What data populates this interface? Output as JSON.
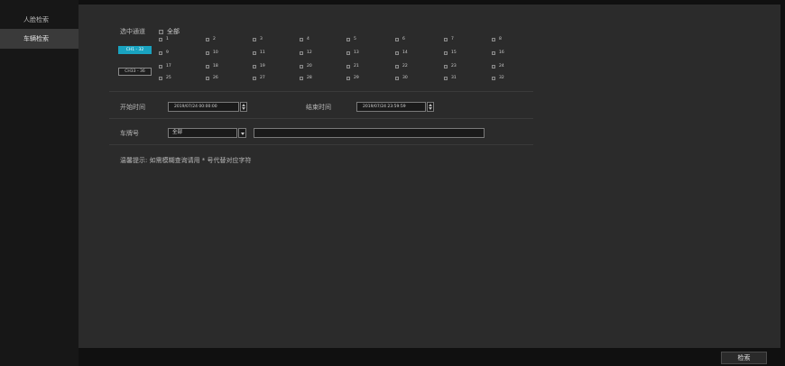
{
  "sidebar": {
    "items": [
      {
        "label": "人脸检索"
      },
      {
        "label": "车辆检索"
      }
    ]
  },
  "channels": {
    "label": "选中通道",
    "all_label": "全部",
    "groups": [
      {
        "label": "CH1 - 32"
      },
      {
        "label": "CH33 - 36"
      }
    ],
    "items": [
      "1",
      "2",
      "3",
      "4",
      "5",
      "6",
      "7",
      "8",
      "9",
      "10",
      "11",
      "12",
      "13",
      "14",
      "15",
      "16",
      "17",
      "18",
      "19",
      "20",
      "21",
      "22",
      "23",
      "24",
      "25",
      "26",
      "27",
      "28",
      "29",
      "30",
      "31",
      "32"
    ]
  },
  "time": {
    "start_label": "开始时间",
    "start_value": "2019/07/24 00:00:00",
    "end_label": "结束时间",
    "end_value": "2019/07/24 23:59:59"
  },
  "plate": {
    "label": "车牌号",
    "select_value": "全部",
    "input_value": ""
  },
  "tip": "温馨提示: 如需模糊查询请用 * 号代替对应字符",
  "footer": {
    "search_label": "检索"
  },
  "colors": {
    "accent": "#19a3c0",
    "panel": "#2b2b2b",
    "sidebar": "#171717"
  }
}
